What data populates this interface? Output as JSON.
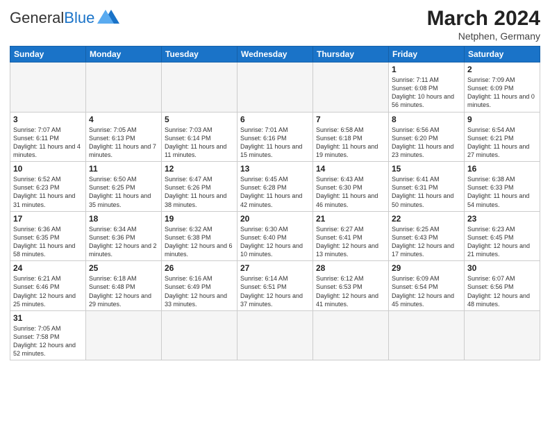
{
  "header": {
    "logo_general": "General",
    "logo_blue": "Blue",
    "month_year": "March 2024",
    "location": "Netphen, Germany"
  },
  "weekdays": [
    "Sunday",
    "Monday",
    "Tuesday",
    "Wednesday",
    "Thursday",
    "Friday",
    "Saturday"
  ],
  "weeks": [
    [
      {
        "day": "",
        "info": ""
      },
      {
        "day": "",
        "info": ""
      },
      {
        "day": "",
        "info": ""
      },
      {
        "day": "",
        "info": ""
      },
      {
        "day": "",
        "info": ""
      },
      {
        "day": "1",
        "info": "Sunrise: 7:11 AM\nSunset: 6:08 PM\nDaylight: 10 hours and 56 minutes."
      },
      {
        "day": "2",
        "info": "Sunrise: 7:09 AM\nSunset: 6:09 PM\nDaylight: 11 hours and 0 minutes."
      }
    ],
    [
      {
        "day": "3",
        "info": "Sunrise: 7:07 AM\nSunset: 6:11 PM\nDaylight: 11 hours and 4 minutes."
      },
      {
        "day": "4",
        "info": "Sunrise: 7:05 AM\nSunset: 6:13 PM\nDaylight: 11 hours and 7 minutes."
      },
      {
        "day": "5",
        "info": "Sunrise: 7:03 AM\nSunset: 6:14 PM\nDaylight: 11 hours and 11 minutes."
      },
      {
        "day": "6",
        "info": "Sunrise: 7:01 AM\nSunset: 6:16 PM\nDaylight: 11 hours and 15 minutes."
      },
      {
        "day": "7",
        "info": "Sunrise: 6:58 AM\nSunset: 6:18 PM\nDaylight: 11 hours and 19 minutes."
      },
      {
        "day": "8",
        "info": "Sunrise: 6:56 AM\nSunset: 6:20 PM\nDaylight: 11 hours and 23 minutes."
      },
      {
        "day": "9",
        "info": "Sunrise: 6:54 AM\nSunset: 6:21 PM\nDaylight: 11 hours and 27 minutes."
      }
    ],
    [
      {
        "day": "10",
        "info": "Sunrise: 6:52 AM\nSunset: 6:23 PM\nDaylight: 11 hours and 31 minutes."
      },
      {
        "day": "11",
        "info": "Sunrise: 6:50 AM\nSunset: 6:25 PM\nDaylight: 11 hours and 35 minutes."
      },
      {
        "day": "12",
        "info": "Sunrise: 6:47 AM\nSunset: 6:26 PM\nDaylight: 11 hours and 38 minutes."
      },
      {
        "day": "13",
        "info": "Sunrise: 6:45 AM\nSunset: 6:28 PM\nDaylight: 11 hours and 42 minutes."
      },
      {
        "day": "14",
        "info": "Sunrise: 6:43 AM\nSunset: 6:30 PM\nDaylight: 11 hours and 46 minutes."
      },
      {
        "day": "15",
        "info": "Sunrise: 6:41 AM\nSunset: 6:31 PM\nDaylight: 11 hours and 50 minutes."
      },
      {
        "day": "16",
        "info": "Sunrise: 6:38 AM\nSunset: 6:33 PM\nDaylight: 11 hours and 54 minutes."
      }
    ],
    [
      {
        "day": "17",
        "info": "Sunrise: 6:36 AM\nSunset: 6:35 PM\nDaylight: 11 hours and 58 minutes."
      },
      {
        "day": "18",
        "info": "Sunrise: 6:34 AM\nSunset: 6:36 PM\nDaylight: 12 hours and 2 minutes."
      },
      {
        "day": "19",
        "info": "Sunrise: 6:32 AM\nSunset: 6:38 PM\nDaylight: 12 hours and 6 minutes."
      },
      {
        "day": "20",
        "info": "Sunrise: 6:30 AM\nSunset: 6:40 PM\nDaylight: 12 hours and 10 minutes."
      },
      {
        "day": "21",
        "info": "Sunrise: 6:27 AM\nSunset: 6:41 PM\nDaylight: 12 hours and 13 minutes."
      },
      {
        "day": "22",
        "info": "Sunrise: 6:25 AM\nSunset: 6:43 PM\nDaylight: 12 hours and 17 minutes."
      },
      {
        "day": "23",
        "info": "Sunrise: 6:23 AM\nSunset: 6:45 PM\nDaylight: 12 hours and 21 minutes."
      }
    ],
    [
      {
        "day": "24",
        "info": "Sunrise: 6:21 AM\nSunset: 6:46 PM\nDaylight: 12 hours and 25 minutes."
      },
      {
        "day": "25",
        "info": "Sunrise: 6:18 AM\nSunset: 6:48 PM\nDaylight: 12 hours and 29 minutes."
      },
      {
        "day": "26",
        "info": "Sunrise: 6:16 AM\nSunset: 6:49 PM\nDaylight: 12 hours and 33 minutes."
      },
      {
        "day": "27",
        "info": "Sunrise: 6:14 AM\nSunset: 6:51 PM\nDaylight: 12 hours and 37 minutes."
      },
      {
        "day": "28",
        "info": "Sunrise: 6:12 AM\nSunset: 6:53 PM\nDaylight: 12 hours and 41 minutes."
      },
      {
        "day": "29",
        "info": "Sunrise: 6:09 AM\nSunset: 6:54 PM\nDaylight: 12 hours and 45 minutes."
      },
      {
        "day": "30",
        "info": "Sunrise: 6:07 AM\nSunset: 6:56 PM\nDaylight: 12 hours and 48 minutes."
      }
    ],
    [
      {
        "day": "31",
        "info": "Sunrise: 7:05 AM\nSunset: 7:58 PM\nDaylight: 12 hours and 52 minutes."
      },
      {
        "day": "",
        "info": ""
      },
      {
        "day": "",
        "info": ""
      },
      {
        "day": "",
        "info": ""
      },
      {
        "day": "",
        "info": ""
      },
      {
        "day": "",
        "info": ""
      },
      {
        "day": "",
        "info": ""
      }
    ]
  ]
}
